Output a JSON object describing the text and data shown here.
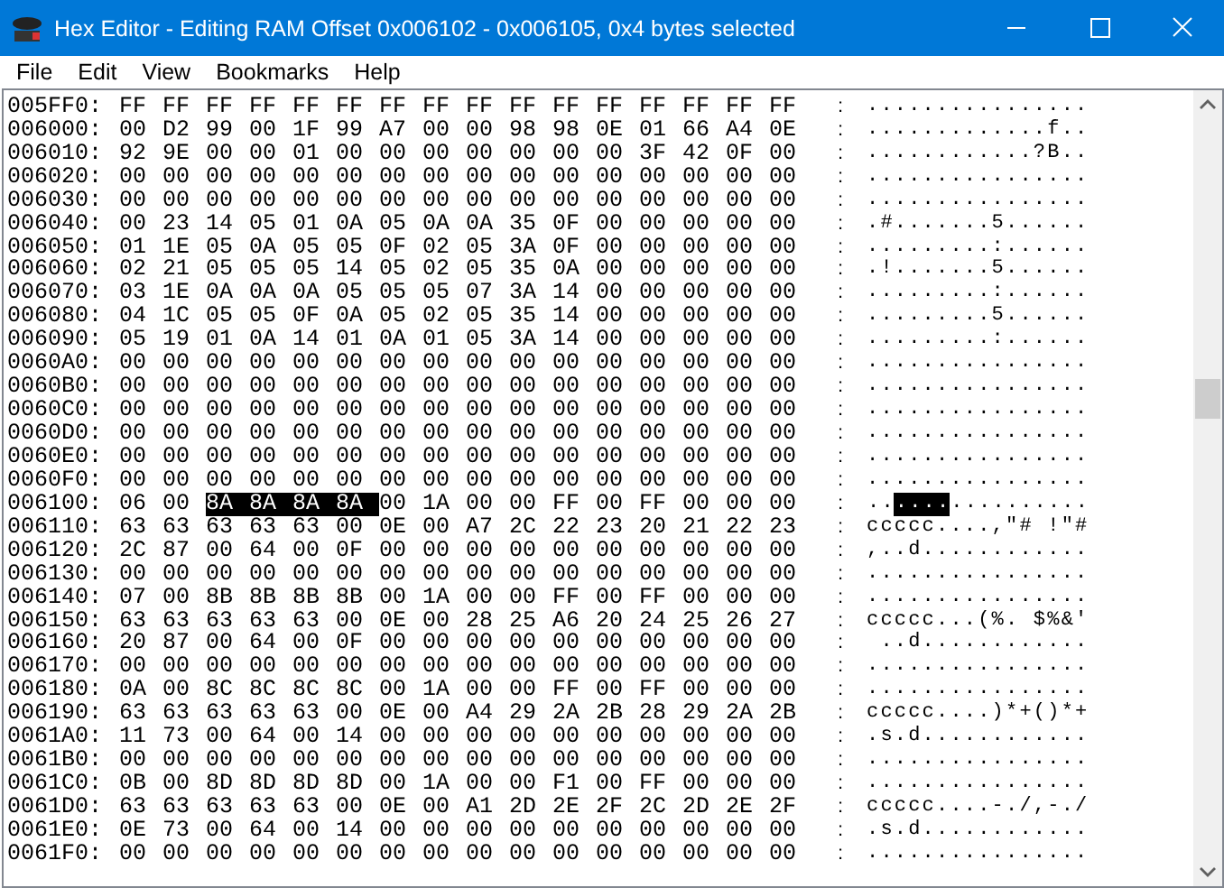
{
  "window": {
    "title": "Hex Editor - Editing RAM Offset 0x006102 - 0x006105, 0x4 bytes selected"
  },
  "menu": [
    {
      "label": "File"
    },
    {
      "label": "Edit"
    },
    {
      "label": "View"
    },
    {
      "label": "Bookmarks"
    },
    {
      "label": "Help"
    }
  ],
  "rows": [
    {
      "offset": "005FF0:",
      "hex": [
        "FF",
        "FF",
        "FF",
        "FF",
        "FF",
        "FF",
        "FF",
        "FF",
        "FF",
        "FF",
        "FF",
        "FF",
        "FF",
        "FF",
        "FF",
        "FF"
      ],
      "sep": ":",
      "ascii": "................"
    },
    {
      "offset": "006000:",
      "hex": [
        "00",
        "D2",
        "99",
        "00",
        "1F",
        "99",
        "A7",
        "00",
        "00",
        "98",
        "98",
        "0E",
        "01",
        "66",
        "A4",
        "0E"
      ],
      "sep": ":",
      "ascii": ".............f.."
    },
    {
      "offset": "006010:",
      "hex": [
        "92",
        "9E",
        "00",
        "00",
        "01",
        "00",
        "00",
        "00",
        "00",
        "00",
        "00",
        "00",
        "3F",
        "42",
        "0F",
        "00"
      ],
      "sep": ":",
      "ascii": "............?B.."
    },
    {
      "offset": "006020:",
      "hex": [
        "00",
        "00",
        "00",
        "00",
        "00",
        "00",
        "00",
        "00",
        "00",
        "00",
        "00",
        "00",
        "00",
        "00",
        "00",
        "00"
      ],
      "sep": ":",
      "ascii": "................"
    },
    {
      "offset": "006030:",
      "hex": [
        "00",
        "00",
        "00",
        "00",
        "00",
        "00",
        "00",
        "00",
        "00",
        "00",
        "00",
        "00",
        "00",
        "00",
        "00",
        "00"
      ],
      "sep": ":",
      "ascii": "................"
    },
    {
      "offset": "006040:",
      "hex": [
        "00",
        "23",
        "14",
        "05",
        "01",
        "0A",
        "05",
        "0A",
        "0A",
        "35",
        "0F",
        "00",
        "00",
        "00",
        "00",
        "00"
      ],
      "sep": ":",
      "ascii": ".#.......5......"
    },
    {
      "offset": "006050:",
      "hex": [
        "01",
        "1E",
        "05",
        "0A",
        "05",
        "05",
        "0F",
        "02",
        "05",
        "3A",
        "0F",
        "00",
        "00",
        "00",
        "00",
        "00"
      ],
      "sep": ":",
      "ascii": ".........:......"
    },
    {
      "offset": "006060:",
      "hex": [
        "02",
        "21",
        "05",
        "05",
        "05",
        "14",
        "05",
        "02",
        "05",
        "35",
        "0A",
        "00",
        "00",
        "00",
        "00",
        "00"
      ],
      "sep": ":",
      "ascii": ".!.......5......"
    },
    {
      "offset": "006070:",
      "hex": [
        "03",
        "1E",
        "0A",
        "0A",
        "0A",
        "05",
        "05",
        "05",
        "07",
        "3A",
        "14",
        "00",
        "00",
        "00",
        "00",
        "00"
      ],
      "sep": ":",
      "ascii": ".........:......"
    },
    {
      "offset": "006080:",
      "hex": [
        "04",
        "1C",
        "05",
        "05",
        "0F",
        "0A",
        "05",
        "02",
        "05",
        "35",
        "14",
        "00",
        "00",
        "00",
        "00",
        "00"
      ],
      "sep": ":",
      "ascii": ".........5......"
    },
    {
      "offset": "006090:",
      "hex": [
        "05",
        "19",
        "01",
        "0A",
        "14",
        "01",
        "0A",
        "01",
        "05",
        "3A",
        "14",
        "00",
        "00",
        "00",
        "00",
        "00"
      ],
      "sep": ":",
      "ascii": ".........:......"
    },
    {
      "offset": "0060A0:",
      "hex": [
        "00",
        "00",
        "00",
        "00",
        "00",
        "00",
        "00",
        "00",
        "00",
        "00",
        "00",
        "00",
        "00",
        "00",
        "00",
        "00"
      ],
      "sep": ":",
      "ascii": "................"
    },
    {
      "offset": "0060B0:",
      "hex": [
        "00",
        "00",
        "00",
        "00",
        "00",
        "00",
        "00",
        "00",
        "00",
        "00",
        "00",
        "00",
        "00",
        "00",
        "00",
        "00"
      ],
      "sep": ":",
      "ascii": "................"
    },
    {
      "offset": "0060C0:",
      "hex": [
        "00",
        "00",
        "00",
        "00",
        "00",
        "00",
        "00",
        "00",
        "00",
        "00",
        "00",
        "00",
        "00",
        "00",
        "00",
        "00"
      ],
      "sep": ":",
      "ascii": "................"
    },
    {
      "offset": "0060D0:",
      "hex": [
        "00",
        "00",
        "00",
        "00",
        "00",
        "00",
        "00",
        "00",
        "00",
        "00",
        "00",
        "00",
        "00",
        "00",
        "00",
        "00"
      ],
      "sep": ":",
      "ascii": "................"
    },
    {
      "offset": "0060E0:",
      "hex": [
        "00",
        "00",
        "00",
        "00",
        "00",
        "00",
        "00",
        "00",
        "00",
        "00",
        "00",
        "00",
        "00",
        "00",
        "00",
        "00"
      ],
      "sep": ":",
      "ascii": "................"
    },
    {
      "offset": "0060F0:",
      "hex": [
        "00",
        "00",
        "00",
        "00",
        "00",
        "00",
        "00",
        "00",
        "00",
        "00",
        "00",
        "00",
        "00",
        "00",
        "00",
        "00"
      ],
      "sep": ":",
      "ascii": "................"
    },
    {
      "offset": "006100:",
      "hex": [
        "06",
        "00",
        "8A",
        "8A",
        "8A",
        "8A",
        "00",
        "1A",
        "00",
        "00",
        "FF",
        "00",
        "FF",
        "00",
        "00",
        "00"
      ],
      "sep": ":",
      "ascii": "................",
      "selected": [
        false,
        false,
        true,
        true,
        true,
        true,
        false,
        false,
        false,
        false,
        false,
        false,
        false,
        false,
        false,
        false
      ]
    },
    {
      "offset": "006110:",
      "hex": [
        "63",
        "63",
        "63",
        "63",
        "63",
        "00",
        "0E",
        "00",
        "A7",
        "2C",
        "22",
        "23",
        "20",
        "21",
        "22",
        "23"
      ],
      "sep": ":",
      "ascii": "ccccc....,\"# !\"#"
    },
    {
      "offset": "006120:",
      "hex": [
        "2C",
        "87",
        "00",
        "64",
        "00",
        "0F",
        "00",
        "00",
        "00",
        "00",
        "00",
        "00",
        "00",
        "00",
        "00",
        "00"
      ],
      "sep": ":",
      "ascii": ",..d............"
    },
    {
      "offset": "006130:",
      "hex": [
        "00",
        "00",
        "00",
        "00",
        "00",
        "00",
        "00",
        "00",
        "00",
        "00",
        "00",
        "00",
        "00",
        "00",
        "00",
        "00"
      ],
      "sep": ":",
      "ascii": "................"
    },
    {
      "offset": "006140:",
      "hex": [
        "07",
        "00",
        "8B",
        "8B",
        "8B",
        "8B",
        "00",
        "1A",
        "00",
        "00",
        "FF",
        "00",
        "FF",
        "00",
        "00",
        "00"
      ],
      "sep": ":",
      "ascii": "................"
    },
    {
      "offset": "006150:",
      "hex": [
        "63",
        "63",
        "63",
        "63",
        "63",
        "00",
        "0E",
        "00",
        "28",
        "25",
        "A6",
        "20",
        "24",
        "25",
        "26",
        "27"
      ],
      "sep": ":",
      "ascii": "ccccc...(%. $%&'"
    },
    {
      "offset": "006160:",
      "hex": [
        "20",
        "87",
        "00",
        "64",
        "00",
        "0F",
        "00",
        "00",
        "00",
        "00",
        "00",
        "00",
        "00",
        "00",
        "00",
        "00"
      ],
      "sep": ":",
      "ascii": " ..d............"
    },
    {
      "offset": "006170:",
      "hex": [
        "00",
        "00",
        "00",
        "00",
        "00",
        "00",
        "00",
        "00",
        "00",
        "00",
        "00",
        "00",
        "00",
        "00",
        "00",
        "00"
      ],
      "sep": ":",
      "ascii": "................"
    },
    {
      "offset": "006180:",
      "hex": [
        "0A",
        "00",
        "8C",
        "8C",
        "8C",
        "8C",
        "00",
        "1A",
        "00",
        "00",
        "FF",
        "00",
        "FF",
        "00",
        "00",
        "00"
      ],
      "sep": ":",
      "ascii": "................"
    },
    {
      "offset": "006190:",
      "hex": [
        "63",
        "63",
        "63",
        "63",
        "63",
        "00",
        "0E",
        "00",
        "A4",
        "29",
        "2A",
        "2B",
        "28",
        "29",
        "2A",
        "2B"
      ],
      "sep": ":",
      "ascii": "ccccc....)*+()*+"
    },
    {
      "offset": "0061A0:",
      "hex": [
        "11",
        "73",
        "00",
        "64",
        "00",
        "14",
        "00",
        "00",
        "00",
        "00",
        "00",
        "00",
        "00",
        "00",
        "00",
        "00"
      ],
      "sep": ":",
      "ascii": ".s.d............"
    },
    {
      "offset": "0061B0:",
      "hex": [
        "00",
        "00",
        "00",
        "00",
        "00",
        "00",
        "00",
        "00",
        "00",
        "00",
        "00",
        "00",
        "00",
        "00",
        "00",
        "00"
      ],
      "sep": ":",
      "ascii": "................"
    },
    {
      "offset": "0061C0:",
      "hex": [
        "0B",
        "00",
        "8D",
        "8D",
        "8D",
        "8D",
        "00",
        "1A",
        "00",
        "00",
        "F1",
        "00",
        "FF",
        "00",
        "00",
        "00"
      ],
      "sep": ":",
      "ascii": "................"
    },
    {
      "offset": "0061D0:",
      "hex": [
        "63",
        "63",
        "63",
        "63",
        "63",
        "00",
        "0E",
        "00",
        "A1",
        "2D",
        "2E",
        "2F",
        "2C",
        "2D",
        "2E",
        "2F"
      ],
      "sep": ":",
      "ascii": "ccccc....-./,-./"
    },
    {
      "offset": "0061E0:",
      "hex": [
        "0E",
        "73",
        "00",
        "64",
        "00",
        "14",
        "00",
        "00",
        "00",
        "00",
        "00",
        "00",
        "00",
        "00",
        "00",
        "00"
      ],
      "sep": ":",
      "ascii": ".s.d............"
    },
    {
      "offset": "0061F0:",
      "hex": [
        "00",
        "00",
        "00",
        "00",
        "00",
        "00",
        "00",
        "00",
        "00",
        "00",
        "00",
        "00",
        "00",
        "00",
        "00",
        "00"
      ],
      "sep": ":",
      "ascii": "................"
    }
  ]
}
